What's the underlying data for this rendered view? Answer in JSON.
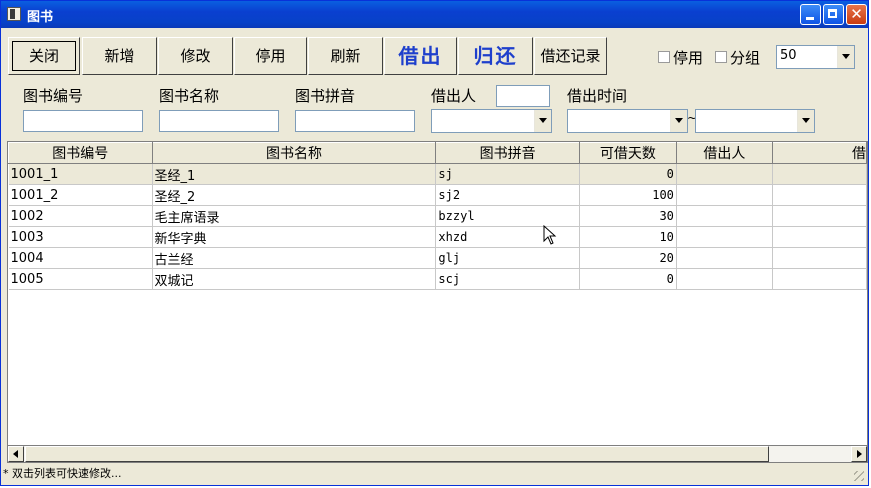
{
  "window": {
    "title": "图书"
  },
  "toolbar": {
    "close_label": "关闭",
    "add_label": "新增",
    "edit_label": "修改",
    "disable_label": "停用",
    "refresh_label": "刷新",
    "borrow_label": "借出",
    "return_label": "归还",
    "history_label": "借还记录",
    "disabled_checkbox_label": "停用",
    "group_checkbox_label": "分组",
    "page_size_value": "50"
  },
  "filters": {
    "book_id_label": "图书编号",
    "book_name_label": "图书名称",
    "pinyin_label": "图书拼音",
    "borrower_label": "借出人",
    "borrow_time_label": "借出时间",
    "range_separator": "~"
  },
  "table": {
    "columns": [
      "图书编号",
      "图书名称",
      "图书拼音",
      "可借天数",
      "借出人",
      "借"
    ],
    "rows": [
      [
        "1001_1",
        "圣经_1",
        "sj",
        "0",
        ""
      ],
      [
        "1001_2",
        "圣经_2",
        "sj2",
        "100",
        ""
      ],
      [
        "1002",
        "毛主席语录",
        "bzzyl",
        "30",
        ""
      ],
      [
        "1003",
        "新华字典",
        "xhzd",
        "10",
        ""
      ],
      [
        "1004",
        "古兰经",
        "glj",
        "20",
        ""
      ],
      [
        "1005",
        "双城记",
        "scj",
        "0",
        ""
      ]
    ]
  },
  "status": {
    "hint": "* 双击列表可快速修改..."
  }
}
